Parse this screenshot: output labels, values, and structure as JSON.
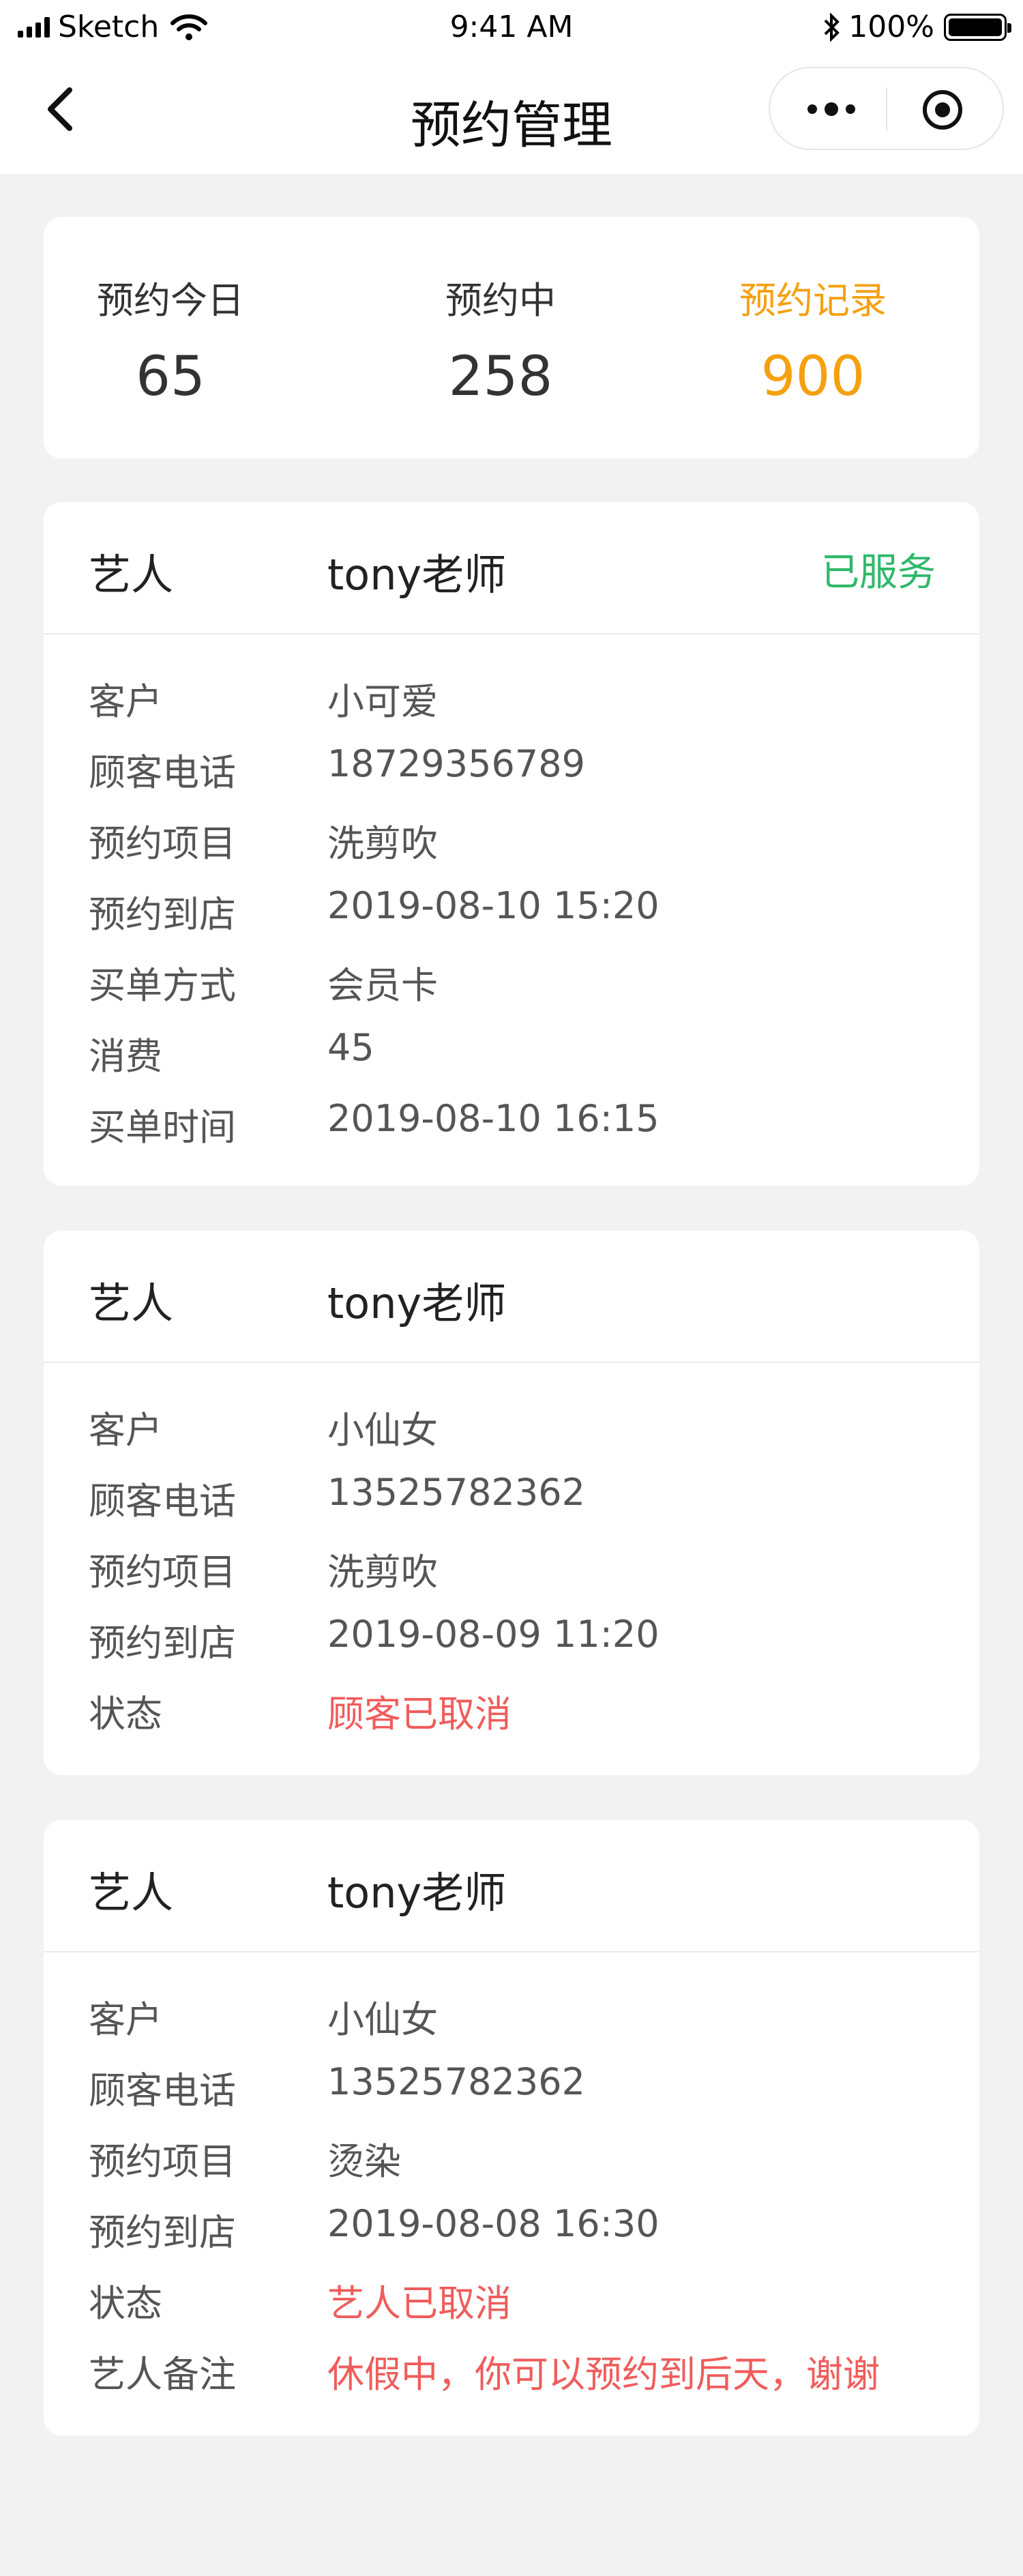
{
  "statusbar": {
    "carrier": "Sketch",
    "time": "9:41 AM",
    "battery": "100%"
  },
  "nav": {
    "title": "预约管理"
  },
  "stats": [
    {
      "label": "预约今日",
      "value": "65"
    },
    {
      "label": "预约中",
      "value": "258"
    },
    {
      "label": "预约记录",
      "value": "900",
      "highlight_color": "#f5a010"
    }
  ],
  "cards": [
    {
      "artist_label": "艺人",
      "artist": "tony老师",
      "status": "已服务",
      "rows": [
        {
          "k": "客户",
          "v": "小可爱"
        },
        {
          "k": "顾客电话",
          "v": "18729356789"
        },
        {
          "k": "预约项目",
          "v": "洗剪吹"
        },
        {
          "k": "预约到店",
          "v": "2019-08-10   15:20"
        },
        {
          "k": "买单方式",
          "v": "会员卡"
        },
        {
          "k": "消费",
          "v": "45"
        },
        {
          "k": "买单时间",
          "v": "2019-08-10   16:15"
        }
      ]
    },
    {
      "artist_label": "艺人",
      "artist": "tony老师",
      "rows": [
        {
          "k": "客户",
          "v": "小仙女"
        },
        {
          "k": "顾客电话",
          "v": "13525782362"
        },
        {
          "k": "预约项目",
          "v": "洗剪吹"
        },
        {
          "k": "预约到店",
          "v": "2019-08-09   11:20"
        },
        {
          "k": "状态",
          "v": "顾客已取消"
        }
      ]
    },
    {
      "artist_label": "艺人",
      "artist": "tony老师",
      "rows": [
        {
          "k": "客户",
          "v": "小仙女"
        },
        {
          "k": "顾客电话",
          "v": "13525782362"
        },
        {
          "k": "预约项目",
          "v": "烫染"
        },
        {
          "k": "预约到店",
          "v": "2019-08-08   16:30"
        },
        {
          "k": "状态",
          "v": "艺人已取消"
        },
        {
          "k": "艺人备注",
          "v": "休假中，你可以预约到后天，谢谢"
        }
      ]
    }
  ],
  "colors": {
    "accent_orange": "#f5a010",
    "served_green": "#2fb86a",
    "cancel_red": "#f05c5c"
  },
  "icons": [
    "signal-icon",
    "wifi-icon",
    "bluetooth-icon",
    "battery-icon",
    "back-arrow-icon",
    "more-dots-icon",
    "target-icon"
  ]
}
